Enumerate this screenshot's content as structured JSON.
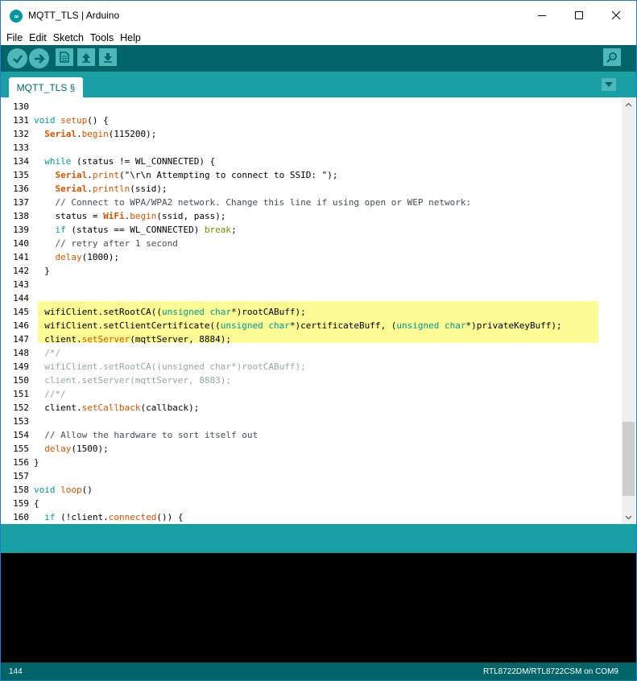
{
  "window": {
    "title": "MQTT_TLS | Arduino",
    "icon": "arduino-logo-icon",
    "controls": [
      "minimize-icon",
      "maximize-icon",
      "close-icon"
    ]
  },
  "menu": [
    "File",
    "Edit",
    "Sketch",
    "Tools",
    "Help"
  ],
  "toolbar": {
    "buttons": [
      "verify-icon",
      "upload-icon",
      "new-icon",
      "open-icon",
      "save-icon"
    ],
    "serial_monitor": "serial-monitor-icon"
  },
  "tabs": [
    {
      "label": "MQTT_TLS §"
    }
  ],
  "editor": {
    "lines": [
      {
        "n": "130",
        "text": ""
      },
      {
        "n": "131",
        "text": "void setup() {"
      },
      {
        "n": "132",
        "text": "  Serial.begin(115200);"
      },
      {
        "n": "133",
        "text": ""
      },
      {
        "n": "134",
        "text": "  while (status != WL_CONNECTED) {"
      },
      {
        "n": "135",
        "text": "    Serial.print(\"\\r\\n Attempting to connect to SSID: \");"
      },
      {
        "n": "136",
        "text": "    Serial.println(ssid);"
      },
      {
        "n": "137",
        "text": "    // Connect to WPA/WPA2 network. Change this line if using open or WEP network:"
      },
      {
        "n": "138",
        "text": "    status = WiFi.begin(ssid, pass);"
      },
      {
        "n": "139",
        "text": "    if (status == WL_CONNECTED) break;"
      },
      {
        "n": "140",
        "text": "    // retry after 1 second"
      },
      {
        "n": "141",
        "text": "    delay(1000);"
      },
      {
        "n": "142",
        "text": "  }"
      },
      {
        "n": "143",
        "text": ""
      },
      {
        "n": "144",
        "text": ""
      },
      {
        "n": "145",
        "text": "  wifiClient.setRootCA((unsigned char*)rootCABuff);"
      },
      {
        "n": "146",
        "text": "  wifiClient.setClientCertificate((unsigned char*)certificateBuff, (unsigned char*)privateKeyBuff);"
      },
      {
        "n": "147",
        "text": "  client.setServer(mqttServer, 8884);"
      },
      {
        "n": "148",
        "text": "  /*/"
      },
      {
        "n": "149",
        "text": "  wifiClient.setRootCA((unsigned char*)rootCABuff);"
      },
      {
        "n": "150",
        "text": "  client.setServer(mqttServer, 8883);"
      },
      {
        "n": "151",
        "text": "  //*/"
      },
      {
        "n": "152",
        "text": "  client.setCallback(callback);"
      },
      {
        "n": "153",
        "text": ""
      },
      {
        "n": "154",
        "text": "  // Allow the hardware to sort itself out"
      },
      {
        "n": "155",
        "text": "  delay(1500);"
      },
      {
        "n": "156",
        "text": "}"
      },
      {
        "n": "157",
        "text": ""
      },
      {
        "n": "158",
        "text": "void loop()"
      },
      {
        "n": "159",
        "text": "{"
      },
      {
        "n": "160",
        "text": "  if (!client.connected()) {"
      }
    ],
    "highlighted_lines": [
      "145",
      "146",
      "147"
    ],
    "dimmed_lines": [
      "148",
      "149",
      "150",
      "151"
    ]
  },
  "status": {
    "line_number": "144",
    "board": "RTL8722DM/RTL8722CSM on COM9"
  },
  "colors": {
    "toolbar": "#006468",
    "tabbar": "#17a1a5",
    "button": "#4db7bb",
    "highlight": "#fbfb94",
    "keyword": "#00979c",
    "function": "#d35400",
    "console": "#000000"
  }
}
